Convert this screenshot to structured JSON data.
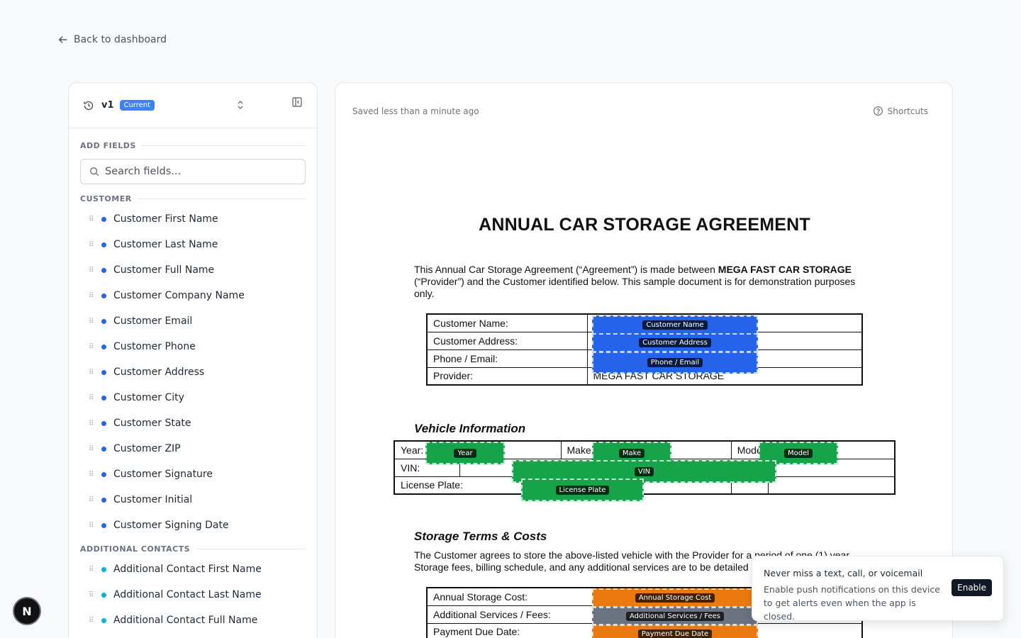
{
  "nav": {
    "back_label": "Back to dashboard"
  },
  "sidebar": {
    "version": "v1",
    "version_badge": "Current",
    "add_fields_label": "ADD FIELDS",
    "search_placeholder": "Search fields...",
    "groups": [
      {
        "label": "CUSTOMER",
        "color": "#2563eb",
        "items": [
          "Customer First Name",
          "Customer Last Name",
          "Customer Full Name",
          "Customer Company Name",
          "Customer Email",
          "Customer Phone",
          "Customer Address",
          "Customer City",
          "Customer State",
          "Customer ZIP",
          "Customer Signature",
          "Customer Initial",
          "Customer Signing Date"
        ]
      },
      {
        "label": "ADDITIONAL CONTACTS",
        "color": "#06b6d4",
        "items": [
          "Additional Contact First Name",
          "Additional Contact Last Name",
          "Additional Contact Full Name"
        ]
      }
    ]
  },
  "editor": {
    "saved_status": "Saved less than a minute ago",
    "shortcuts_label": "Shortcuts"
  },
  "document": {
    "title": "ANNUAL CAR STORAGE AGREEMENT",
    "intro_pre": "This Annual Car Storage Agreement (“Agreement”) is made between ",
    "intro_bold": "MEGA FAST CAR STORAGE",
    "intro_post": " (“Provider”) and the Customer identified below. This sample document is for demonstration purposes only.",
    "party_rows": [
      {
        "label": "Customer Name:",
        "value": ""
      },
      {
        "label": "Customer Address:",
        "value": ""
      },
      {
        "label": "Phone / Email:",
        "value": ""
      },
      {
        "label": "Provider:",
        "value": "MEGA FAST CAR STORAGE"
      }
    ],
    "vehicle_heading": "Vehicle Information",
    "vehicle": {
      "year_label": "Year:",
      "make_label": "Make",
      "model_label": "Mode",
      "vin_label": "VIN:",
      "plate_label": "License Plate:"
    },
    "storage_heading": "Storage Terms & Costs",
    "storage_text": "The Customer agrees to store the above-listed vehicle with the Provider for a period of one (1) year. Storage fees, billing schedule, and any additional services are to be detailed below.",
    "cost_rows": [
      "Annual Storage Cost:",
      "Additional Services / Fees:",
      "Payment Due Date:"
    ]
  },
  "overlays": {
    "customer_name": "Customer Name",
    "customer_address": "Customer Address",
    "phone_email": "Phone / Email",
    "year": "Year",
    "make": "Make",
    "model": "Model",
    "vin": "VIN",
    "license_plate": "License Plate",
    "annual_storage_cost": "Annual Storage Cost",
    "additional_services": "Additional Services / Fees",
    "payment_due_date": "Payment Due Date"
  },
  "notification": {
    "title": "Never miss a text, call, or voicemail",
    "body": "Enable push notifications on this device to get alerts even when the app is closed.",
    "button": "Enable"
  },
  "avatar": {
    "letter": "N"
  },
  "colors": {
    "customer_overlay": "#2563eb",
    "vehicle_overlay": "#16a34a",
    "cost_overlay": "#ea7a10",
    "accent": "#3b82f6"
  }
}
